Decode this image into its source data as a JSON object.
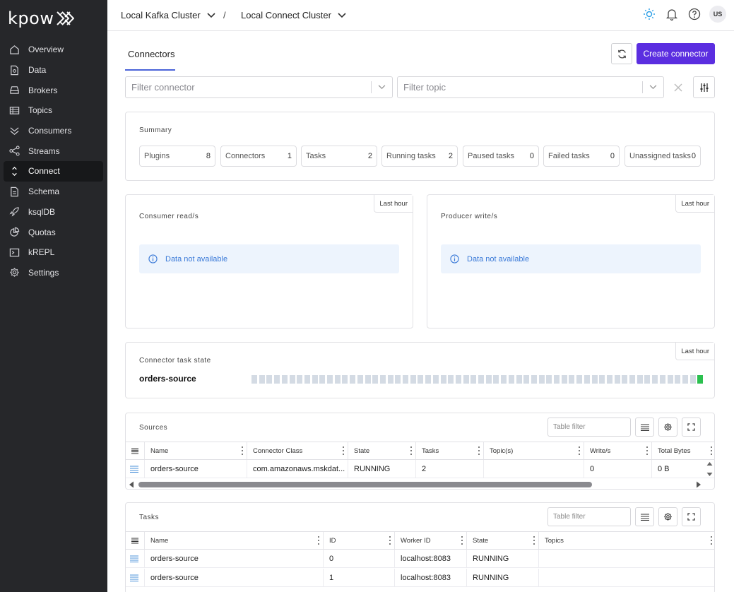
{
  "app": {
    "logo_text": "kpow"
  },
  "sidebar": {
    "items": [
      {
        "label": "Overview",
        "icon": "home-icon"
      },
      {
        "label": "Data",
        "icon": "document-icon"
      },
      {
        "label": "Brokers",
        "icon": "broker-icon"
      },
      {
        "label": "Topics",
        "icon": "table-icon"
      },
      {
        "label": "Consumers",
        "icon": "chevrons-down-icon"
      },
      {
        "label": "Streams",
        "icon": "share-icon"
      },
      {
        "label": "Connect",
        "icon": "connect-icon",
        "active": true
      },
      {
        "label": "Schema",
        "icon": "schema-icon"
      },
      {
        "label": "ksqlDB",
        "icon": "rocket-icon"
      },
      {
        "label": "Quotas",
        "icon": "pie-icon"
      },
      {
        "label": "kREPL",
        "icon": "terminal-icon"
      },
      {
        "label": "Settings",
        "icon": "gear-icon"
      }
    ]
  },
  "header": {
    "cluster": "Local Kafka Cluster",
    "separator": "/",
    "connect_cluster": "Local Connect Cluster",
    "avatar": "US"
  },
  "main": {
    "tab": "Connectors",
    "create_button": "Create connector",
    "filter_connector_placeholder": "Filter connector",
    "filter_topic_placeholder": "Filter topic"
  },
  "summary": {
    "title": "Summary",
    "chips": [
      {
        "label": "Plugins",
        "value": "8"
      },
      {
        "label": "Connectors",
        "value": "1"
      },
      {
        "label": "Tasks",
        "value": "2"
      },
      {
        "label": "Running tasks",
        "value": "2"
      },
      {
        "label": "Paused tasks",
        "value": "0"
      },
      {
        "label": "Failed tasks",
        "value": "0"
      },
      {
        "label": "Unassigned tasks",
        "value": "0"
      }
    ]
  },
  "metrics": {
    "consumer": {
      "title": "Consumer read/s",
      "range": "Last hour",
      "message": "Data not available"
    },
    "producer": {
      "title": "Producer write/s",
      "range": "Last hour",
      "message": "Data not available"
    }
  },
  "task_state": {
    "title": "Connector task state",
    "range": "Last hour",
    "connector": "orders-source",
    "segments": 60,
    "ok_segments": 1
  },
  "sources": {
    "title": "Sources",
    "filter_placeholder": "Table filter",
    "columns": [
      "Name",
      "Connector Class",
      "State",
      "Tasks",
      "Topic(s)",
      "Write/s",
      "Total Bytes"
    ],
    "rows": [
      {
        "name": "orders-source",
        "class": "com.amazonaws.mskdat...",
        "state": "RUNNING",
        "tasks": "2",
        "topics": "",
        "write": "0",
        "bytes": "0 B"
      }
    ]
  },
  "tasks": {
    "title": "Tasks",
    "filter_placeholder": "Table filter",
    "columns": [
      "Name",
      "ID",
      "Worker ID",
      "State",
      "Topics"
    ],
    "rows": [
      {
        "name": "orders-source",
        "id": "0",
        "worker": "localhost:8083",
        "state": "RUNNING",
        "topics": ""
      },
      {
        "name": "orders-source",
        "id": "1",
        "worker": "localhost:8083",
        "state": "RUNNING",
        "topics": ""
      }
    ]
  },
  "colors": {
    "accent": "#5b2ee0",
    "tab_underline": "#4a63d8",
    "info": "#3b7ad8",
    "ok": "#2bc04f",
    "sidebar": "#26272a"
  }
}
